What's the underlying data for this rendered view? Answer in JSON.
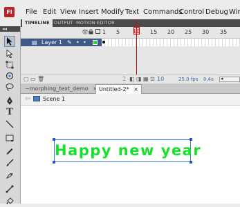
{
  "app": {
    "logo": "Fl"
  },
  "menu": [
    "File",
    "Edit",
    "View",
    "Insert",
    "Modify",
    "Text",
    "Commands",
    "Control",
    "Debug",
    "Wind"
  ],
  "timeline": {
    "tabs": [
      "TIMELINE",
      "OUTPUT",
      "MOTION EDITOR"
    ],
    "frame_numbers": [
      "1",
      "5",
      "15",
      "20",
      "25",
      "30",
      "35"
    ],
    "playhead_frame": "10",
    "layer": {
      "name": "Layer 1"
    },
    "fps": "25.0 fps",
    "time": "0.4s"
  },
  "documents": {
    "tabs": [
      {
        "label": "~morphing_text_demo",
        "close": "×"
      },
      {
        "label": "Untitled-2*",
        "close": "×"
      }
    ]
  },
  "editbar": {
    "scene": "Scene 1"
  },
  "stage": {
    "text": "Happy new year",
    "text_color": "#19e02d"
  },
  "icons": {
    "selection": "arrow-icon",
    "subselection": "white-arrow-icon",
    "free_transform": "transform-icon",
    "lasso": "lasso-icon",
    "pen": "pen-icon",
    "text": "T",
    "line": "line-icon",
    "rectangle": "rectangle-icon",
    "pencil": "pencil-icon",
    "brush": "brush-icon",
    "deco": "deco-icon",
    "bone": "bone-icon",
    "paint_bucket": "bucket-icon",
    "eyedropper": "eyedropper-icon"
  }
}
